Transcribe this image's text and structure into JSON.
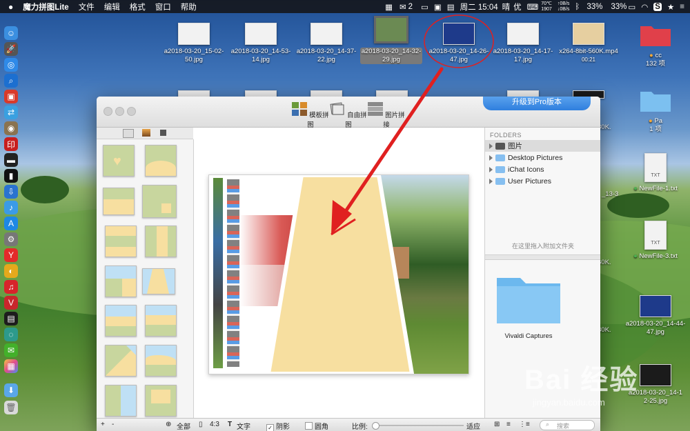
{
  "menubar": {
    "app_name": "魔力拼图Lite",
    "menus": [
      "文件",
      "编辑",
      "格式",
      "窗口",
      "帮助"
    ],
    "wechat_count": "2",
    "datetime": "周二 15:04",
    "weather": "晴",
    "weather_quality": "优",
    "temp_top": "70℃",
    "temp_bottom": "1907",
    "net_up": "0B/s",
    "net_down": "0B/s",
    "battery1": "33%",
    "battery2": "33%"
  },
  "desktop_items": [
    {
      "label": "a2018-03-20_15-02-50.jpg"
    },
    {
      "label": "a2018-03-20_14-53-14.jpg"
    },
    {
      "label": "a2018-03-20_14-37-22.jpg"
    },
    {
      "label": "a2018-03-20_14-32-29.jpg"
    },
    {
      "label": "a2018-03-20_14-26-47.jpg"
    },
    {
      "label": "a2018-03-20_14-17-17.jpg"
    },
    {
      "label": "x264-8bit-560K.mp4",
      "sub": "00:21"
    },
    {
      "label": "cc",
      "sub": "132 项"
    }
  ],
  "right_items": [
    {
      "label": "Pa",
      "sub": "1 项"
    },
    {
      "label": "NewFile-1.txt",
      "badge": "TXT"
    },
    {
      "label": "NewFile-3.txt",
      "badge": "TXT"
    },
    {
      "label": "a2018-03-20_14-44-47.jpg"
    },
    {
      "label": "a2018-03-20_14-1"
    },
    {
      "label": "2-25.jpg"
    }
  ],
  "right_partial": [
    "80K.",
    "_13-3",
    "60K.",
    "80K."
  ],
  "toolbar": {
    "tools": [
      "模板拼图",
      "自由拼图",
      "图片拼接"
    ],
    "upgrade_label": "升级到Pro版本"
  },
  "sidebar": {
    "heading": "FOLDERS",
    "folders": [
      "图片",
      "Desktop Pictures",
      "iChat Icons",
      "User Pictures"
    ],
    "drop_hint": "在这里拖入附加文件夹",
    "folder_item": "Vivaldi Captures"
  },
  "bottom_bar": {
    "plus": "+",
    "minus": "-",
    "all_label": "全部",
    "ratio": "4:3",
    "text_label": "文字",
    "shadow_label": "阴影",
    "round_label": "圆角",
    "scale_label": "比例:",
    "fit_label": "适应",
    "search_placeholder": "搜索"
  },
  "watermark": {
    "brand": "Bai 经验",
    "url": "jingyan.baidu.com"
  },
  "colors": {
    "accent": "#2f7fde",
    "template_green": "#c8d69e",
    "template_yellow": "#f7dfa0",
    "template_blue": "#bfe0f5",
    "annotation_red": "#e02020"
  },
  "template_shape": "trapezoid",
  "shadow_checked": true,
  "round_checked": false
}
